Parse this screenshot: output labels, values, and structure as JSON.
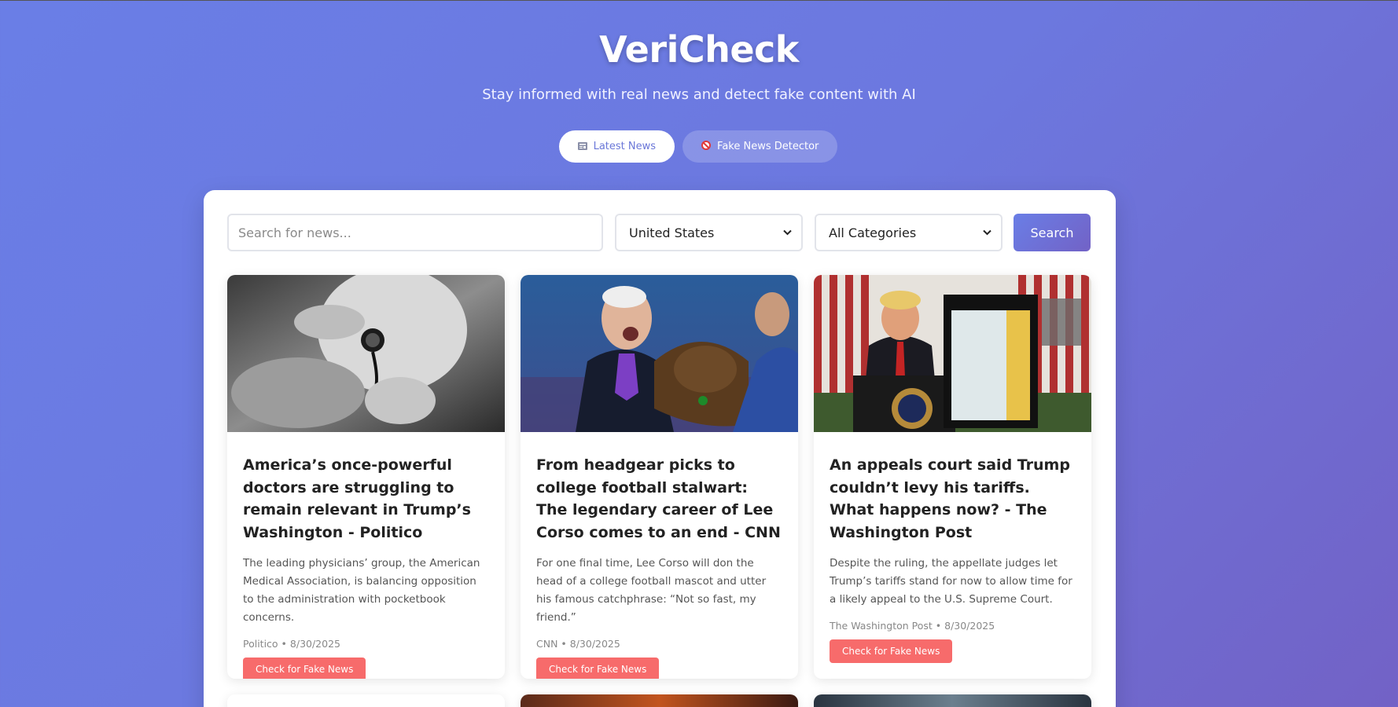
{
  "app": {
    "title": "VeriCheck",
    "subtitle": "Stay informed with real news and detect fake content with AI"
  },
  "tabs": [
    {
      "label": "Latest News",
      "icon": "newspaper-icon",
      "active": true
    },
    {
      "label": "Fake News Detector",
      "icon": "prohibited-icon",
      "active": false
    }
  ],
  "search": {
    "placeholder": "Search for news...",
    "value": "",
    "country": "United States",
    "category": "All Categories",
    "button_label": "Search"
  },
  "articles": [
    {
      "title": "America’s once-powerful doctors are struggling to remain relevant in Trump’s Washington - Politico",
      "description": "The leading physicians’ group, the American Medical Association, is balancing opposition to the administration with pocketbook concerns.",
      "source": "Politico",
      "date": "8/30/2025",
      "meta": "Politico • 8/30/2025",
      "button_label": "Check for Fake News"
    },
    {
      "title": "From headgear picks to college football stalwart: The legendary career of Lee Corso comes to an end - CNN",
      "description": "For one final time, Lee Corso will don the head of a college football mascot and utter his famous catchphrase: “Not so fast, my friend.”",
      "source": "CNN",
      "date": "8/30/2025",
      "meta": "CNN • 8/30/2025",
      "button_label": "Check for Fake News"
    },
    {
      "title": "An appeals court said Trump couldn’t levy his tariffs. What happens now? - The Washington Post",
      "description": "Despite the ruling, the appellate judges let Trump’s tariffs stand for now to allow time for a likely appeal to the U.S. Supreme Court.",
      "source": "The Washington Post",
      "date": "8/30/2025",
      "meta": "The Washington Post • 8/30/2025",
      "button_label": "Check for Fake News"
    }
  ],
  "colors": {
    "accent": "#6a7ee6",
    "accent_dark": "#7262c6",
    "check_button": "#f76b6b"
  }
}
